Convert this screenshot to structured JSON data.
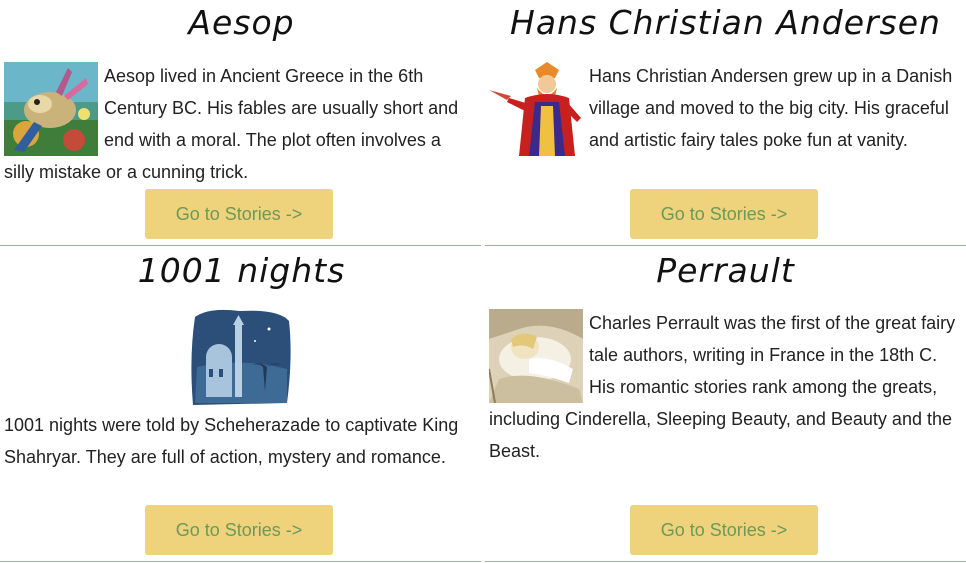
{
  "sections": [
    {
      "title": "Aesop",
      "image_icon": "aesop-donkey-painting-icon",
      "description": "Aesop lived in Ancient Greece in the 6th Century BC. His fables are usually short and end with a moral. The plot often involves a silly mistake or a cunning trick.",
      "button_label": "Go to Stories ->"
    },
    {
      "title": "Hans Christian Andersen",
      "image_icon": "emperor-illustration-icon",
      "description": "Hans Christian Andersen grew up in a Danish village and moved to the big city. His graceful and artistic fairy tales poke fun at vanity.",
      "button_label": "Go to Stories ->"
    },
    {
      "title": "1001 nights",
      "image_icon": "arabian-night-city-icon",
      "description": "1001 nights were told by Scheherazade to captivate King Shahryar. They are full of action, mystery and romance.",
      "button_label": "Go to Stories ->"
    },
    {
      "title": "Perrault",
      "image_icon": "sleeping-beauty-sketch-icon",
      "description": "Charles Perrault was the first of the great fairy tale authors, writing in France in the 18th C. His romantic stories rank among the greats, including Cinderella, Sleeping Beauty, and Beauty and the Beast.",
      "button_label": "Go to Stories ->"
    }
  ],
  "colors": {
    "button_bg": "#efd27c",
    "button_text": "#6a9a5a",
    "divider": "#9fb79f"
  }
}
